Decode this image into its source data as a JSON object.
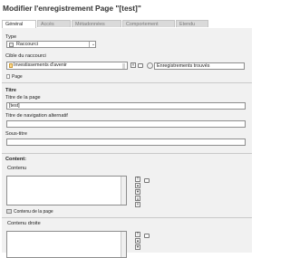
{
  "page": {
    "title": "Modifier l'enregistrement Page \"[test]\""
  },
  "tabs": [
    {
      "label": "Général"
    },
    {
      "label": "Accès"
    },
    {
      "label": "Métadonnées"
    },
    {
      "label": "Comportement"
    },
    {
      "label": "Etendu"
    }
  ],
  "type_section": {
    "label": "Type",
    "value": "Raccourci"
  },
  "shortcut": {
    "label": "Cible du raccourci",
    "selected": "Investissements d'avenir",
    "search_result": "Enregistrements trouvés",
    "page_link": "Page"
  },
  "titre_section": {
    "heading": "Titre",
    "page_title_label": "Titre de la page",
    "page_title_value": "[test]",
    "nav_title_label": "Titre de navigation alternatif",
    "nav_title_value": "",
    "subtitle_label": "Sous-titre",
    "subtitle_value": ""
  },
  "content_section": {
    "heading": "Content:",
    "contenu_label": "Contenu",
    "contenu_page_link": "Contenu de la page",
    "contenu_droite_label": "Contenu droite"
  },
  "colors": {
    "panel": "#f1f1f1",
    "tab_active": "#ffffff",
    "tab_inactive": "#dadada"
  }
}
